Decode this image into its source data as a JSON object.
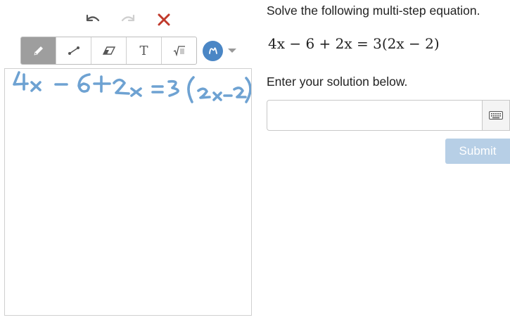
{
  "history": {
    "undo_icon": "undo-arrow-icon",
    "redo_icon": "redo-arrow-icon",
    "clear_icon": "close-x-icon"
  },
  "toolbar": {
    "tools": [
      {
        "icon": "pencil-icon",
        "active": true
      },
      {
        "icon": "line-icon",
        "active": false
      },
      {
        "icon": "eraser-icon",
        "active": false
      },
      {
        "icon": "text-tool-icon",
        "label": "T",
        "active": false
      },
      {
        "icon": "math-tool-icon",
        "active": false
      }
    ],
    "selected_color": "#4a86c5"
  },
  "canvas": {
    "handwriting": "4x-6+2x=3(2x-2)",
    "ink_color": "#6ea2d2"
  },
  "question": {
    "prompt": "Solve the following multi-step equation.",
    "equation": "4x − 6 + 2x = 3(2x − 2)",
    "instruction": "Enter your solution below."
  },
  "answer": {
    "value": "",
    "keyboard_icon": "keyboard-icon"
  },
  "submit": {
    "label": "Submit",
    "disabled": true,
    "color": "#b7cfe6"
  }
}
